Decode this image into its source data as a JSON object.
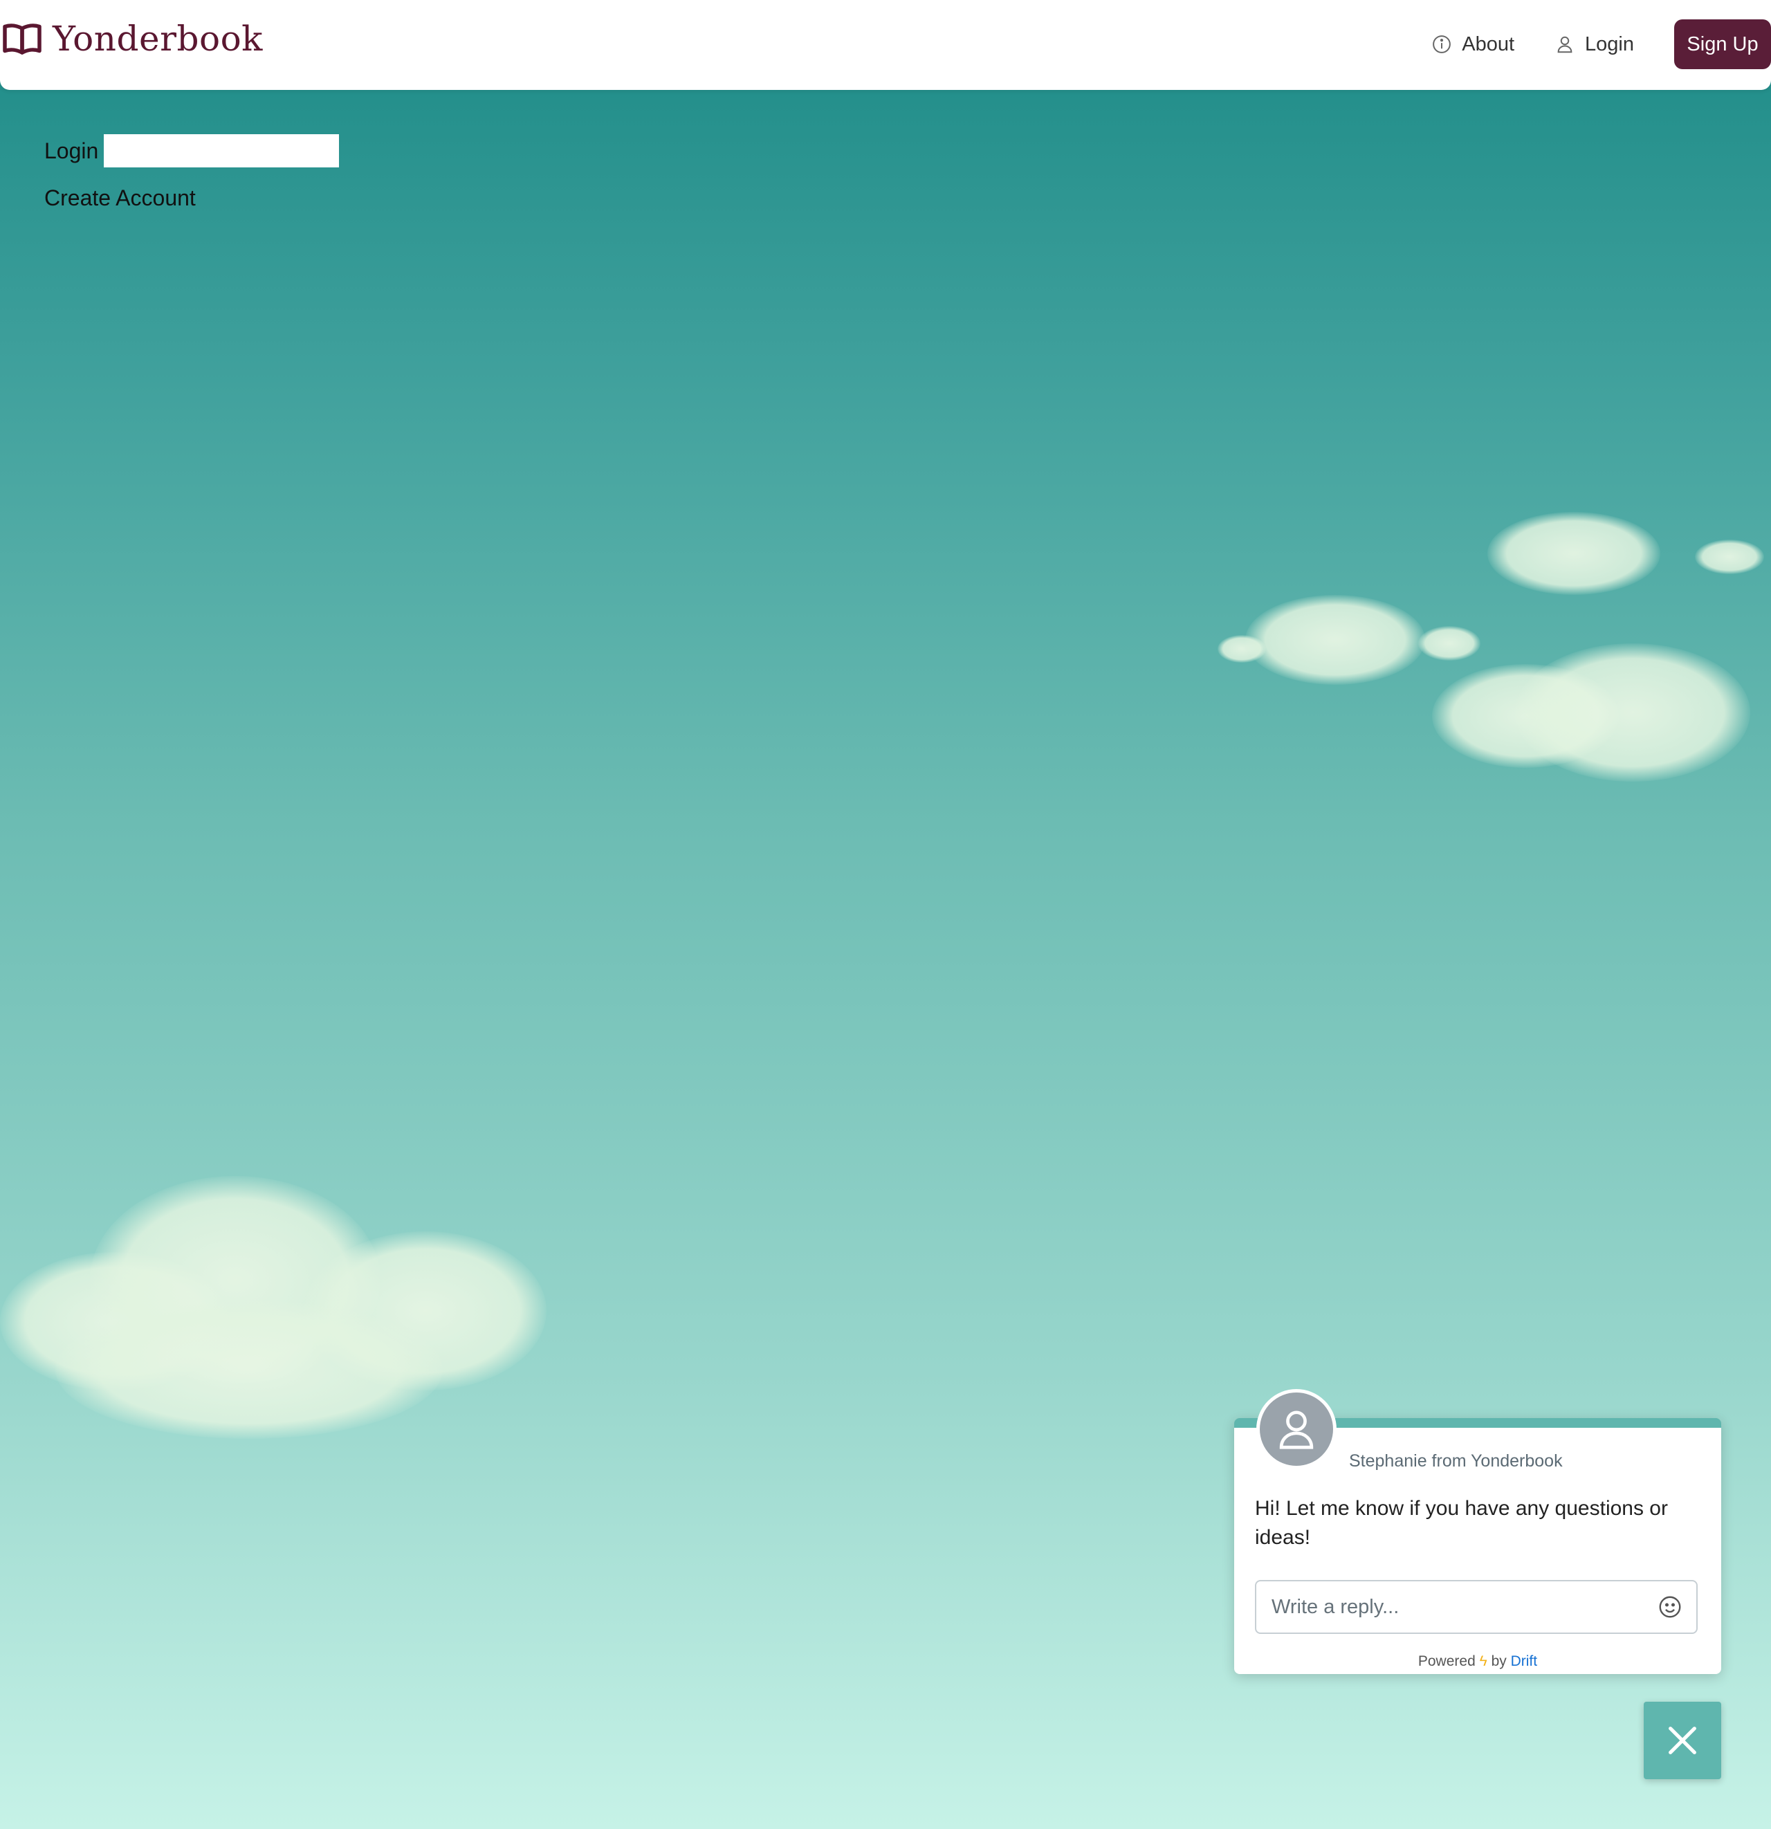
{
  "header": {
    "brand": "Yonderbook",
    "nav": [
      {
        "label": "About",
        "icon": "info-icon"
      },
      {
        "label": "Login",
        "icon": "user-icon"
      }
    ],
    "signup_label": "Sign Up"
  },
  "login": {
    "label": "Login",
    "input_value": "",
    "create_account": "Create Account"
  },
  "chat": {
    "from": "Stephanie from Yonderbook",
    "message": "Hi! Let me know if you have any questions or ideas!",
    "reply_placeholder": "Write a reply...",
    "powered_prefix": "Powered",
    "powered_by": "by",
    "powered_brand": "Drift"
  },
  "colors": {
    "brand": "#5a1730",
    "signup_bg": "#5a1e38",
    "chat_accent": "#5fb6ae",
    "drift_link": "#1671d3"
  }
}
